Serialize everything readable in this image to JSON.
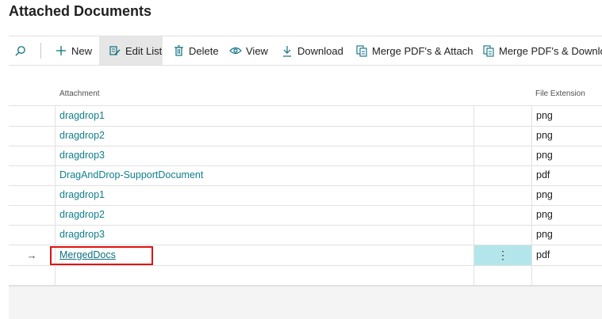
{
  "title": "Attached Documents",
  "toolbar": {
    "new_label": "New",
    "edit_list_label": "Edit List",
    "delete_label": "Delete",
    "view_label": "View",
    "download_label": "Download",
    "merge_attach_label": "Merge PDF's & Attach",
    "merge_download_label": "Merge PDF's & Downlo"
  },
  "columns": {
    "attachment": "Attachment",
    "file_extension": "File Extension"
  },
  "rows": [
    {
      "attachment": "dragdrop1",
      "ext": "png"
    },
    {
      "attachment": "dragdrop2",
      "ext": "png"
    },
    {
      "attachment": "dragdrop3",
      "ext": "png"
    },
    {
      "attachment": "DragAndDrop-SupportDocument",
      "ext": "pdf"
    },
    {
      "attachment": "dragdrop1",
      "ext": "png"
    },
    {
      "attachment": "dragdrop2",
      "ext": "png"
    },
    {
      "attachment": "dragdrop3",
      "ext": "png"
    },
    {
      "attachment": "MergedDocs",
      "ext": "pdf"
    }
  ],
  "current_row_arrow": "→",
  "row_actions_glyph": "⋮",
  "icons": {
    "search": "search-icon",
    "new": "plus-icon",
    "edit_list": "edit-list-icon",
    "delete": "trash-icon",
    "view": "eye-icon",
    "download": "download-icon",
    "merge": "merge-pdf-icon"
  },
  "colors": {
    "link": "#0f7f8c",
    "selected_cell": "#b3e6ea",
    "highlight": "#e01010"
  }
}
